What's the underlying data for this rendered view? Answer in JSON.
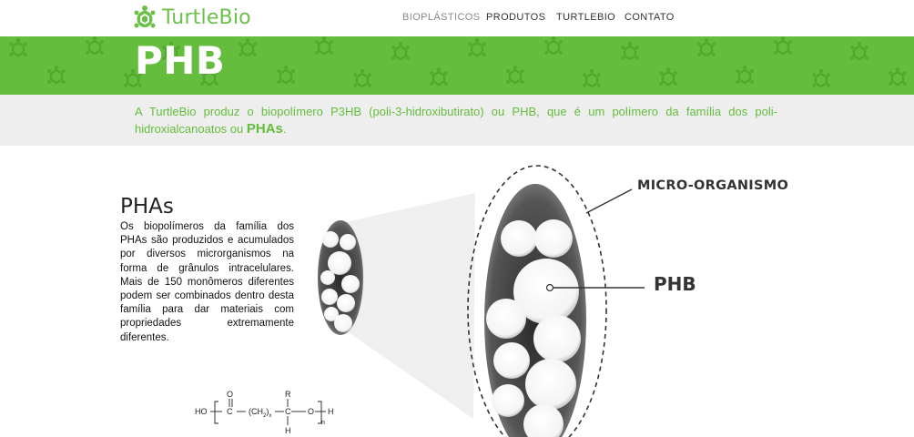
{
  "header": {
    "logo_text": "TurtleBio",
    "nav": [
      {
        "label": "BIOPLÁSTICOS",
        "active": true
      },
      {
        "label": "PRODUTOS",
        "active": false
      },
      {
        "label": "TURTLEBIO",
        "active": false
      },
      {
        "label": "CONTATO",
        "active": false
      }
    ]
  },
  "banner": {
    "title": "PHB",
    "color": "#64bd3c"
  },
  "intro": {
    "text": "A TurtleBio produz o biopolímero P3HB (poli-3-hidroxibutirato) ou PHB, que é um polímero da família dos poli-hidroxialcanoatos ou ",
    "highlight": "PHAs",
    "suffix": "."
  },
  "phas": {
    "title": "PHAs",
    "text": "Os biopolímeros da família dos PHAs são produzidos e acumulados por diversos microrganismos na forma de grânulos intracelulares. Mais de 150 monômeros diferentes podem ser combinados dentro desta família para dar materiais com propriedades extremamente diferentes."
  },
  "diagram": {
    "label_micro": "MICRO-ORGANISMO",
    "label_phb": "PHB"
  },
  "formula": {
    "ho": "HO",
    "o_top": "O",
    "c": "C",
    "ch2x": "(CH",
    "sub2": "2",
    "close_x": ")",
    "x": "x",
    "r": "R",
    "c2": "C",
    "h_bottom": "H",
    "o_mid": "O",
    "h_end": "H",
    "n": "n"
  },
  "colors": {
    "accent": "#64bd3c",
    "text": "#222222",
    "intro_bg": "#eeeeee"
  }
}
